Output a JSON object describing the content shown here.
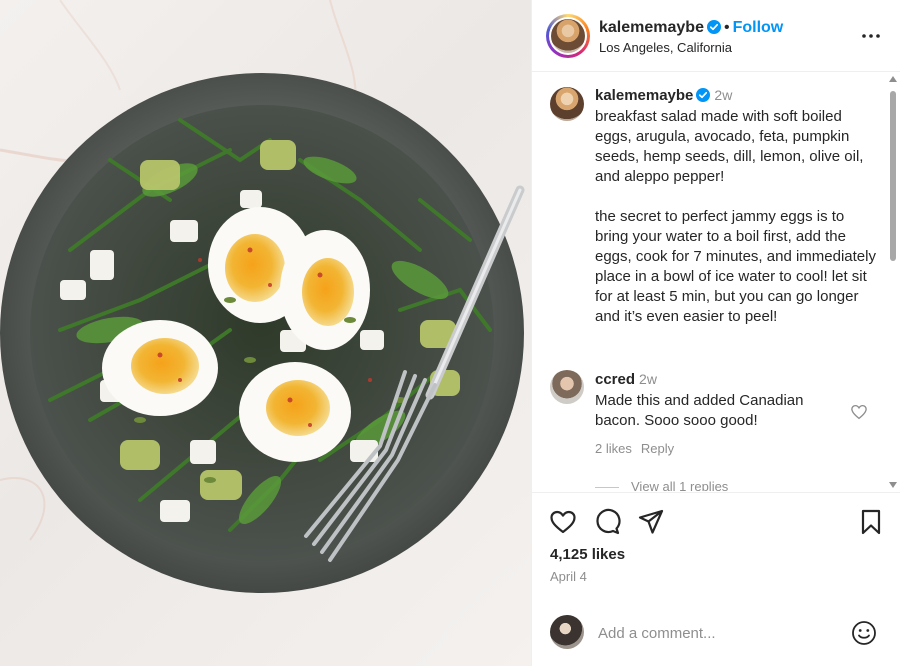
{
  "post": {
    "username": "kalememaybe",
    "follow_label": "Follow",
    "separator": "•",
    "location": "Los Angeles, California"
  },
  "caption": {
    "username": "kalememaybe",
    "time": "2w",
    "paragraph1": "breakfast salad made with soft boiled eggs, arugula, avocado, feta, pumpkin seeds, hemp seeds, dill, lemon, olive oil, and aleppo pepper!",
    "paragraph2": "the secret to perfect jammy eggs is to bring your water to a boil first, add the eggs, cook for 7 minutes, and immediately place in a bowl of ice water to cool! let sit for at least 5 min, but you can go longer and it’s even easier to peel!"
  },
  "comment": {
    "username": "ccred",
    "time": "2w",
    "text": "Made this and added Canadian bacon. Sooo sooo good!",
    "likes": "2 likes",
    "reply_label": "Reply",
    "view_replies": "View all 1 replies"
  },
  "stats": {
    "likes": "4,125 likes",
    "date": "April 4"
  },
  "add_comment": {
    "placeholder": "Add a comment..."
  },
  "colors": {
    "link_blue": "#0095f6",
    "verified_blue": "#0095f6",
    "muted_text": "#8e8e8e"
  },
  "icons": [
    "verified-icon",
    "more-options-icon",
    "heart-icon",
    "comment-icon",
    "share-icon",
    "bookmark-icon",
    "emoji-icon"
  ]
}
